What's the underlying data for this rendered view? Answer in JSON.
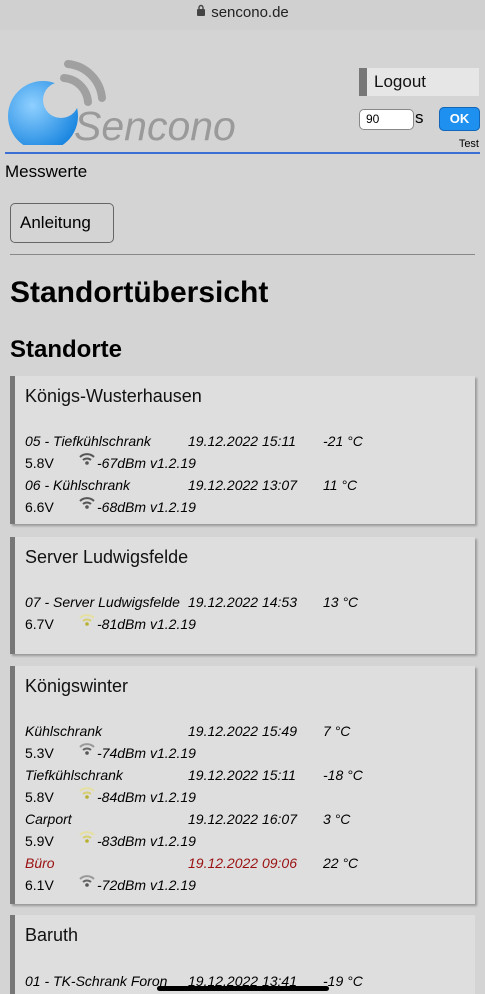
{
  "browser": {
    "url": "sencono.de"
  },
  "header": {
    "logo_text": "Sencono",
    "logout_label": "Logout",
    "refresh_value": "90",
    "refresh_unit": "s",
    "ok_label": "OK",
    "user_label": "Test",
    "colors": {
      "accent_line": "#3b6fd4",
      "ok_button": "#1e90f0"
    }
  },
  "nav": {
    "title": "Messwerte",
    "help_button": "Anleitung"
  },
  "page": {
    "title": "Standortübersicht",
    "subtitle": "Standorte"
  },
  "locations": [
    {
      "name": "Königs-Wusterhausen",
      "sensors": [
        {
          "name": "05 - Tiefkühlschrank",
          "timestamp": "19.12.2022 15:11",
          "temperature": "-21 °C",
          "voltage": "5.8V",
          "rssi": "-67dBm",
          "firmware": "v1.2.19",
          "signal": "good",
          "alert": false
        },
        {
          "name": "06 - Kühlschrank",
          "timestamp": "19.12.2022 13:07",
          "temperature": "11 °C",
          "voltage": "6.6V",
          "rssi": "-68dBm",
          "firmware": "v1.2.19",
          "signal": "good",
          "alert": false
        }
      ]
    },
    {
      "name": "Server Ludwigsfelde",
      "sensors": [
        {
          "name": "07 - Server Ludwigsfelde",
          "timestamp": "19.12.2022 14:53",
          "temperature": "13 °C",
          "voltage": "6.7V",
          "rssi": "-81dBm",
          "firmware": "v1.2.19",
          "signal": "weak",
          "alert": false
        }
      ]
    },
    {
      "name": "Königswinter",
      "sensors": [
        {
          "name": "Kühlschrank",
          "timestamp": "19.12.2022 15:49",
          "temperature": "7 °C",
          "voltage": "5.3V",
          "rssi": "-74dBm",
          "firmware": "v1.2.19",
          "signal": "good",
          "alert": false
        },
        {
          "name": "Tiefkühlschrank",
          "timestamp": "19.12.2022 15:11",
          "temperature": "-18 °C",
          "voltage": "5.8V",
          "rssi": "-84dBm",
          "firmware": "v1.2.19",
          "signal": "weak",
          "alert": false
        },
        {
          "name": "Carport",
          "timestamp": "19.12.2022 16:07",
          "temperature": "3 °C",
          "voltage": "5.9V",
          "rssi": "-83dBm",
          "firmware": "v1.2.19",
          "signal": "weak",
          "alert": false
        },
        {
          "name": "Büro",
          "timestamp": "19.12.2022 09:06",
          "temperature": "22 °C",
          "voltage": "6.1V",
          "rssi": "-72dBm",
          "firmware": "v1.2.19",
          "signal": "good",
          "alert": true
        }
      ]
    },
    {
      "name": "Baruth",
      "sensors": [
        {
          "name": "01 - TK-Schrank Foron",
          "timestamp": "19.12.2022 13:41",
          "temperature": "-19 °C",
          "voltage": "",
          "rssi": "",
          "firmware": "",
          "signal": "good",
          "alert": false
        }
      ]
    }
  ],
  "icons": {
    "lock": "lock-icon",
    "wifi": "wifi-icon"
  },
  "status_colors": {
    "alert_text": "#9a1010",
    "wifi_good": "#555555",
    "wifi_weak": "#b8b030"
  }
}
